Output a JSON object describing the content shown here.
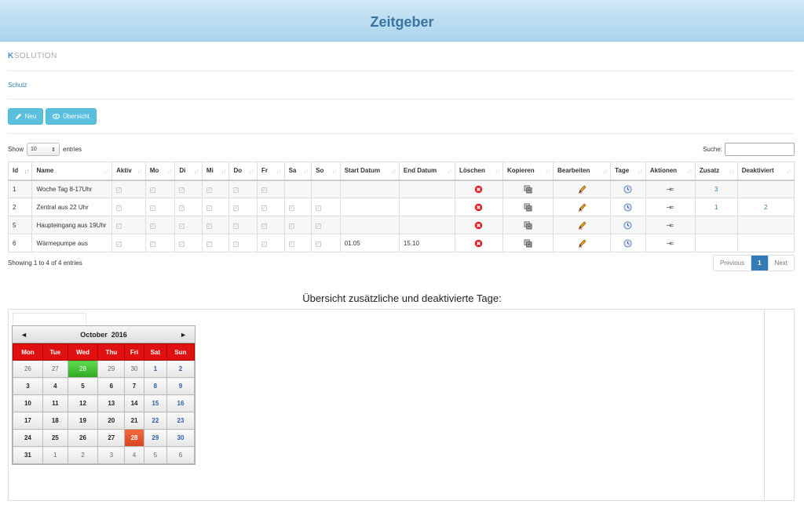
{
  "header": {
    "title": "Zeitgeber"
  },
  "logo": {
    "k": "K",
    "rest": "SOLUTION"
  },
  "breadcrumb": "Schutz",
  "toolbar": {
    "new_label": "Neu",
    "overview_label": "Übersicht"
  },
  "length": {
    "show": "Show",
    "value": "10",
    "entries": "entries"
  },
  "search": {
    "label": "Suche:"
  },
  "table": {
    "headers": [
      "Id",
      "Name",
      "Aktiv",
      "Mo",
      "Di",
      "Mi",
      "Do",
      "Fr",
      "Sa",
      "So",
      "Start Datum",
      "End Datum",
      "Löschen",
      "Kopieren",
      "Bearbeiten",
      "Tage",
      "Aktionen",
      "Zusatz",
      "Deaktiviert"
    ],
    "rows": [
      {
        "id": "1",
        "name": "Woche Tag 8-17Uhr",
        "checks": [
          1,
          1,
          1,
          1,
          1,
          1,
          0,
          0
        ],
        "start": "",
        "end": "",
        "zusatz": "3",
        "deakt": ""
      },
      {
        "id": "2",
        "name": "Zentral aus 22 Uhr",
        "checks": [
          1,
          1,
          1,
          1,
          1,
          1,
          1,
          1
        ],
        "start": "",
        "end": "",
        "zusatz": "1",
        "deakt": "2"
      },
      {
        "id": "5",
        "name": "Haupteingang aus 19Uhr",
        "checks": [
          1,
          1,
          1,
          1,
          1,
          1,
          1,
          1
        ],
        "start": "",
        "end": "",
        "zusatz": "",
        "deakt": ""
      },
      {
        "id": "6",
        "name": "Wärmepumpe aus",
        "checks": [
          1,
          1,
          1,
          1,
          1,
          1,
          1,
          1
        ],
        "start": "01.05",
        "end": "15.10",
        "zusatz": "",
        "deakt": ""
      }
    ]
  },
  "info": "Showing 1 to 4 of 4 entries",
  "pager": {
    "prev": "Previous",
    "page": "1",
    "next": "Next"
  },
  "section_title": "Übersicht zusätzliche und deaktivierte Tage:",
  "calendar": {
    "month": "October",
    "year": "2016",
    "prev": "◄",
    "next": "►",
    "weekdays": [
      "Mon",
      "Tue",
      "Wed",
      "Thu",
      "Fri",
      "Sat",
      "Sun"
    ],
    "weeks": [
      [
        "26",
        "27",
        "28",
        "29",
        "30",
        "1",
        "2"
      ],
      [
        "3",
        "4",
        "5",
        "6",
        "7",
        "8",
        "9"
      ],
      [
        "10",
        "11",
        "12",
        "13",
        "14",
        "15",
        "16"
      ],
      [
        "17",
        "18",
        "19",
        "20",
        "21",
        "22",
        "23"
      ],
      [
        "24",
        "25",
        "26",
        "27",
        "28",
        "29",
        "30"
      ],
      [
        "31",
        "1",
        "2",
        "3",
        "4",
        "5",
        "6"
      ]
    ],
    "colors": {
      "highlight_green": "#3cbf2c",
      "highlight_red": "#e5532a",
      "weekday_header": "#e01010"
    }
  },
  "colors": {
    "topbar": "#bfe0f3",
    "title": "#3b74a0",
    "button": "#5bc0de",
    "link": "#2a7ab8",
    "page_active": "#337ab7"
  }
}
